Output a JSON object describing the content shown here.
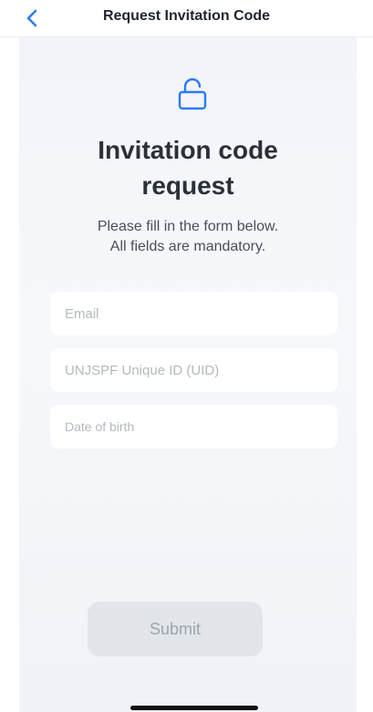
{
  "nav": {
    "title": "Request Invitation Code",
    "back_icon": "chevron-left-icon",
    "accent_color": "#2a7bf6"
  },
  "main": {
    "lock_icon": "unlock-icon",
    "title": "Invitation code\nrequest",
    "subtitle": "Please fill in the form below.\nAll fields are mandatory."
  },
  "form": {
    "email": {
      "value": "",
      "placeholder": "Email"
    },
    "uid": {
      "value": "",
      "placeholder": "UNJSPF Unique ID (UID)"
    },
    "dob": {
      "value": "",
      "placeholder": "Date of birth"
    }
  },
  "submit": {
    "label": "Submit",
    "state": "disabled"
  }
}
